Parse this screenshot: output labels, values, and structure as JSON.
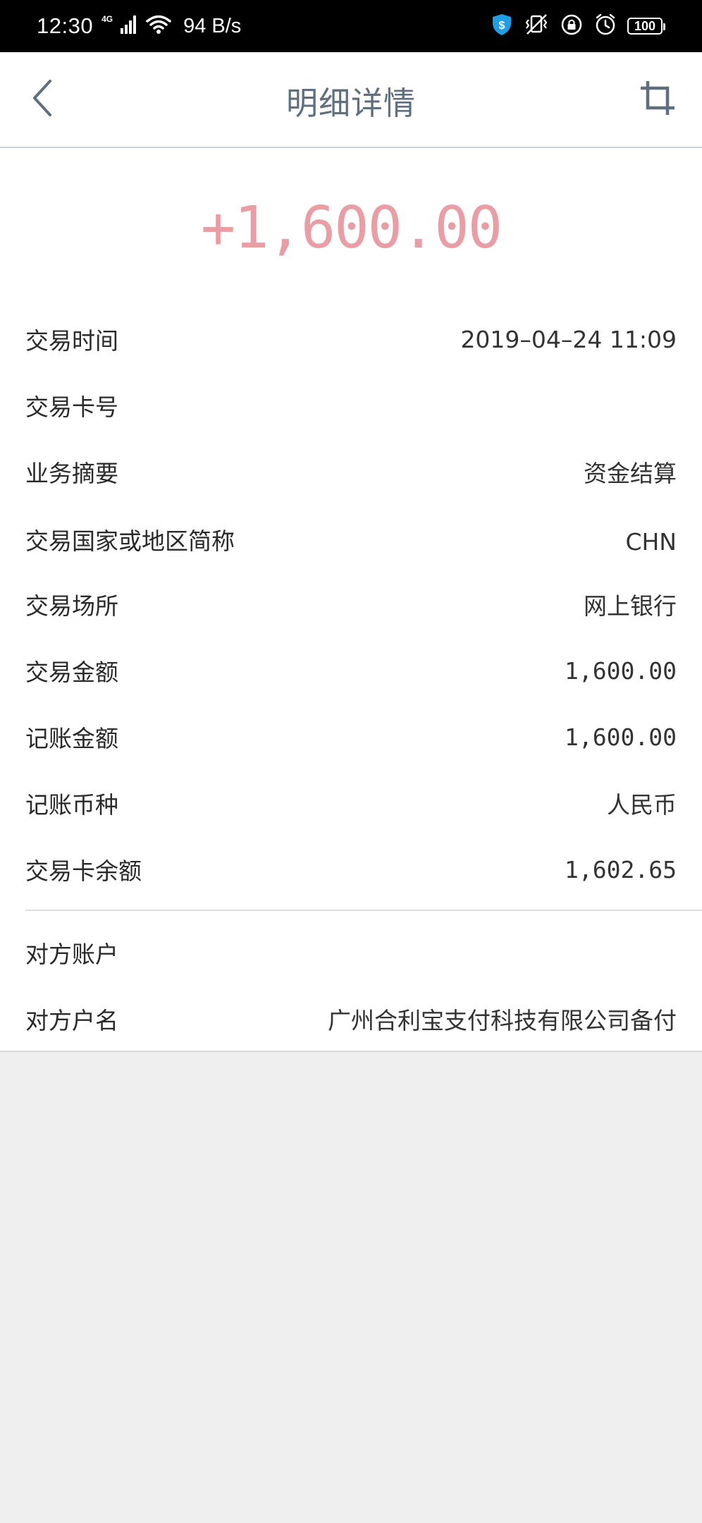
{
  "status_bar": {
    "time": "12:30",
    "network_type": "4G",
    "net_speed": "94 B/s",
    "battery": "100",
    "icons": [
      "signal-icon",
      "wifi-icon",
      "security-shield-icon",
      "vibrate-icon",
      "lock-rotation-icon",
      "alarm-icon",
      "battery-icon"
    ]
  },
  "nav": {
    "title": "明细详情",
    "back_icon": "chevron-left-icon",
    "crop_icon": "crop-icon"
  },
  "amount": "+1,600.00",
  "details": [
    {
      "label": "交易时间",
      "value": "2019–04–24 11:09"
    },
    {
      "label": "交易卡号",
      "value": ""
    },
    {
      "label": "业务摘要",
      "value": "资金结算"
    },
    {
      "label": "交易国家或地区简称",
      "value": "CHN"
    },
    {
      "label": "交易场所",
      "value": "网上银行"
    },
    {
      "label": "交易金额",
      "value": "1,600.00"
    },
    {
      "label": "记账金额",
      "value": "1,600.00"
    },
    {
      "label": "记账币种",
      "value": "人民币"
    },
    {
      "label": "交易卡余额",
      "value": "1,602.65"
    }
  ],
  "counterparty": [
    {
      "label": "对方账户",
      "value": ""
    },
    {
      "label": "对方户名",
      "value": "广州合利宝支付科技有限公司备付"
    }
  ],
  "colors": {
    "amount": "#e89ea4",
    "title": "#5f6f80",
    "background": "#efefef"
  }
}
